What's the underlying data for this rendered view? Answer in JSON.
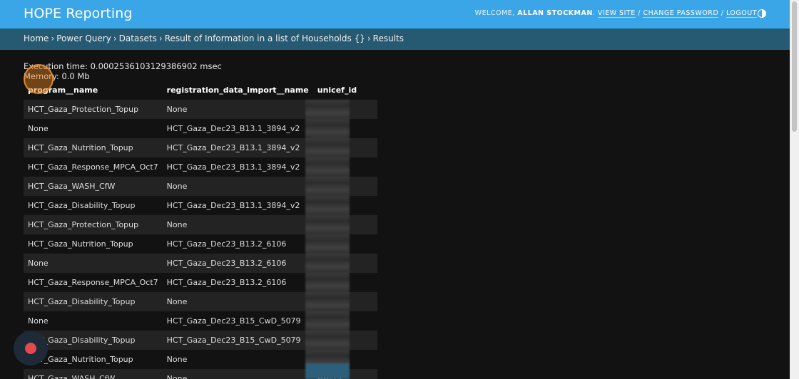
{
  "header": {
    "brand": "HOPE Reporting",
    "welcome": "WELCOME,",
    "user_name": "ALLAN STOCKMAN",
    "view_site": "VIEW SITE",
    "change_password": "CHANGE PASSWORD",
    "logout": "LOGOUT",
    "sep": "/",
    "theme_icon": "contrast-half-circle-icon"
  },
  "breadcrumbs": {
    "items": [
      "Home",
      "Power Query",
      "Datasets",
      "Result of Information in a list of Households {}",
      "Results"
    ],
    "separator": "›"
  },
  "exec": {
    "time": "Execution time: 0.0002536103129386902 msec",
    "memory": "Memory: 0.0 Mb"
  },
  "table": {
    "headers": [
      "program__name",
      "registration_data_import__name",
      "unicef_id"
    ],
    "rows": [
      [
        "HCT_Gaza_Protection_Topup",
        "None",
        "HH-23"
      ],
      [
        "None",
        "HCT_Gaza_Dec23_B13.1_3894_v2",
        "HH-23"
      ],
      [
        "HCT_Gaza_Nutrition_Topup",
        "HCT_Gaza_Dec23_B13.1_3894_v2",
        "HH-23"
      ],
      [
        "HCT_Gaza_Response_MPCA_Oct7",
        "HCT_Gaza_Dec23_B13.1_3894_v2",
        "HH-23"
      ],
      [
        "HCT_Gaza_WASH_CfW",
        "None",
        "HH-23"
      ],
      [
        "HCT_Gaza_Disability_Topup",
        "HCT_Gaza_Dec23_B13.1_3894_v2",
        "HH-23"
      ],
      [
        "HCT_Gaza_Protection_Topup",
        "None",
        "HH-23"
      ],
      [
        "HCT_Gaza_Nutrition_Topup",
        "HCT_Gaza_Dec23_B13.2_6106",
        "HH-23"
      ],
      [
        "None",
        "HCT_Gaza_Dec23_B13.2_6106",
        "HH-23"
      ],
      [
        "HCT_Gaza_Response_MPCA_Oct7",
        "HCT_Gaza_Dec23_B13.2_6106",
        "HH-23"
      ],
      [
        "HCT_Gaza_Disability_Topup",
        "None",
        "HH-23"
      ],
      [
        "None",
        "HCT_Gaza_Dec23_B15_CwD_5079",
        "HH-23"
      ],
      [
        "HCT_Gaza_Disability_Topup",
        "HCT_Gaza_Dec23_B15_CwD_5079",
        "HH-23"
      ],
      [
        "HCT_Gaza_Nutrition_Topup",
        "None",
        "HH-23"
      ],
      [
        "HCT_Gaza_WASH_CfW",
        "None",
        "HH-23"
      ]
    ]
  }
}
